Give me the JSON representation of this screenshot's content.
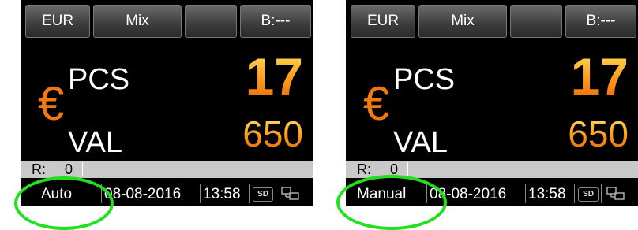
{
  "screens": [
    {
      "tabs": [
        "EUR",
        "Mix",
        "",
        "B:---"
      ],
      "currency_symbol": "€",
      "pcs_label": "PCS",
      "pcs_value": "17",
      "val_label": "VAL",
      "val_value": "650",
      "r_label": "R:",
      "r_value": "0",
      "mode": "Auto",
      "date": "08-08-2016",
      "time": "13:58",
      "sd_icon": "sd-card-icon",
      "network_icon": "network-icon"
    },
    {
      "tabs": [
        "EUR",
        "Mix",
        "",
        "B:---"
      ],
      "currency_symbol": "€",
      "pcs_label": "PCS",
      "pcs_value": "17",
      "val_label": "VAL",
      "val_value": "650",
      "r_label": "R:",
      "r_value": "0",
      "mode": "Manual",
      "date": "08-08-2016",
      "time": "13:58",
      "sd_icon": "sd-card-icon",
      "network_icon": "network-icon"
    }
  ],
  "sd_label": "SD",
  "colors": {
    "highlight_ring": "#22e020",
    "euro": "#f07a10",
    "value_gradient_top": "#ffe15a",
    "value_gradient_bottom": "#e56a0a"
  }
}
